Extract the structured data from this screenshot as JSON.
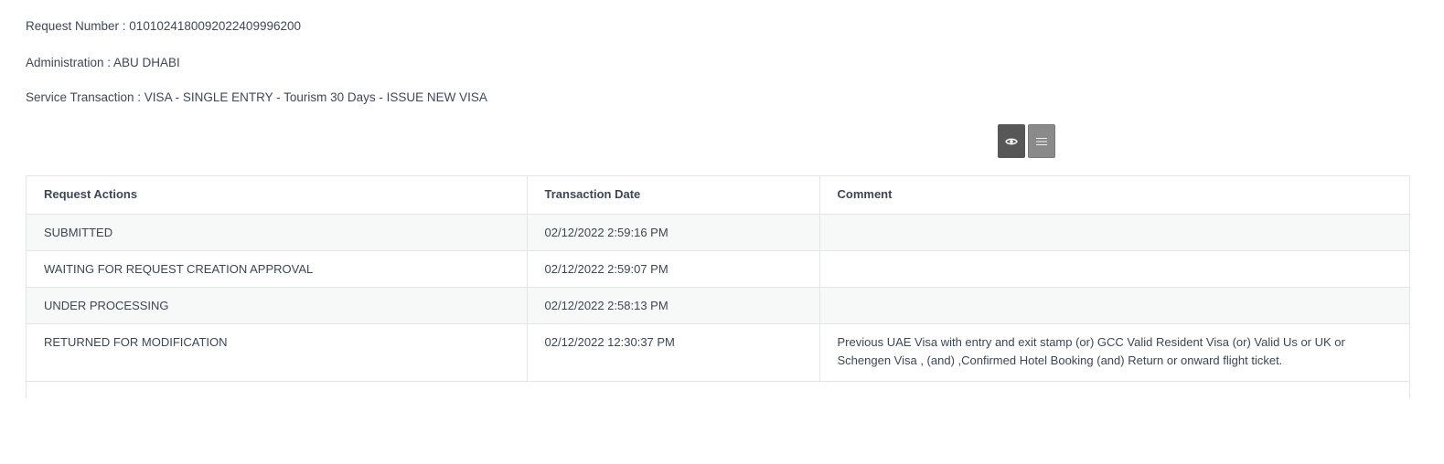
{
  "request": {
    "number_label": "Request Number : 010102418009202240999620​0",
    "administration_label": "Administration : ABU DHABI",
    "service_label": "Service Transaction : VISA - SINGLE ENTRY - Tourism 30 Days - ISSUE NEW VISA"
  },
  "toolbar": {
    "view_icon": "eye-icon",
    "list_icon": "list-icon"
  },
  "table": {
    "headers": [
      "Request Actions",
      "Transaction Date",
      "Comment"
    ],
    "rows": [
      {
        "action": "SUBMITTED",
        "date": "02/12/2022 2:59:16 PM",
        "comment": ""
      },
      {
        "action": "WAITING FOR REQUEST CREATION APPROVAL",
        "date": "02/12/2022 2:59:07 PM",
        "comment": ""
      },
      {
        "action": "UNDER PROCESSING",
        "date": "02/12/2022 2:58:13 PM",
        "comment": ""
      },
      {
        "action": "RETURNED FOR MODIFICATION",
        "date": "02/12/2022 12:30:37 PM",
        "comment": "Previous UAE Visa with entry and exit stamp (or) GCC Valid Resident Visa (or) Valid Us or UK or Schengen Visa , (and) ,Confirmed Hotel Booking (and) Return or onward flight ticket."
      }
    ]
  }
}
